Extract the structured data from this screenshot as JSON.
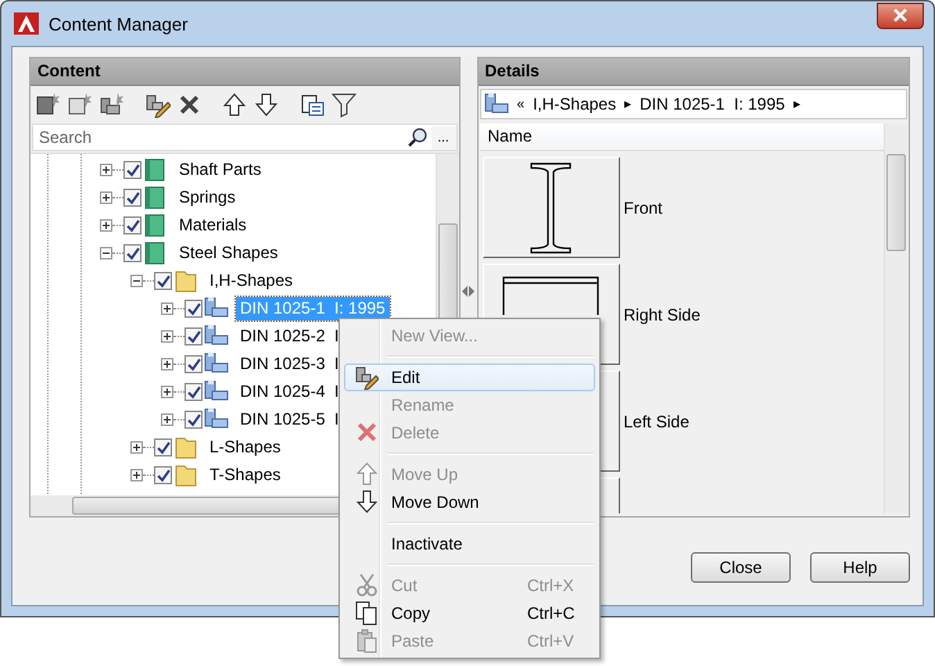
{
  "window": {
    "title": "Content Manager"
  },
  "content_panel": {
    "title": "Content",
    "toolbar": [
      {
        "kind": "new-category"
      },
      {
        "kind": "new-family"
      },
      {
        "kind": "new-member"
      },
      {
        "kind": "edit"
      },
      {
        "kind": "delete"
      },
      {
        "kind": "up"
      },
      {
        "kind": "down"
      },
      {
        "kind": "view"
      },
      {
        "kind": "filter"
      }
    ],
    "search": {
      "placeholder": "Search"
    },
    "search_more": "...",
    "tree": [
      {
        "label": "Shaft Parts",
        "kind": "category",
        "expanded": false,
        "checked": true,
        "selected": false
      },
      {
        "label": "Springs",
        "kind": "category",
        "expanded": false,
        "checked": true,
        "selected": false
      },
      {
        "label": "Materials",
        "kind": "category",
        "expanded": false,
        "checked": true,
        "selected": false
      },
      {
        "label": "Steel Shapes",
        "kind": "category",
        "expanded": true,
        "checked": true,
        "selected": false,
        "children": [
          {
            "label": "I,H-Shapes",
            "kind": "folder",
            "expanded": true,
            "checked": true,
            "selected": false,
            "children": [
              {
                "label": "DIN 1025-1  I: 1995",
                "kind": "part",
                "expanded": false,
                "checked": true,
                "selected": true
              },
              {
                "label": "DIN 1025-2  I",
                "kind": "part",
                "expanded": false,
                "checked": true,
                "selected": false
              },
              {
                "label": "DIN 1025-3  I",
                "kind": "part",
                "expanded": false,
                "checked": true,
                "selected": false
              },
              {
                "label": "DIN 1025-4  I",
                "kind": "part",
                "expanded": false,
                "checked": true,
                "selected": false
              },
              {
                "label": "DIN 1025-5  I",
                "kind": "part",
                "expanded": false,
                "checked": true,
                "selected": false
              }
            ]
          },
          {
            "label": "L-Shapes",
            "kind": "folder",
            "expanded": false,
            "checked": true,
            "selected": false
          },
          {
            "label": "T-Shapes",
            "kind": "folder",
            "expanded": false,
            "checked": true,
            "selected": false
          }
        ]
      }
    ]
  },
  "details_panel": {
    "title": "Details",
    "breadcrumb": [
      {
        "label": "«",
        "kind": "back"
      },
      {
        "label": "I,H-Shapes",
        "kind": "crumb"
      },
      {
        "label": "▸",
        "kind": "arrow"
      },
      {
        "label": "DIN 1025-1  I: 1995",
        "kind": "crumb"
      },
      {
        "label": "▸",
        "kind": "arrow"
      }
    ],
    "column": "Name",
    "views": [
      {
        "label": "Front",
        "kind": "i-beam"
      },
      {
        "label": "Right Side",
        "kind": "side"
      },
      {
        "label": "Left Side",
        "kind": "blank"
      },
      {
        "kind": "blank"
      }
    ]
  },
  "context_menu": [
    {
      "kind": "plain",
      "label": "New View...",
      "disabled": true,
      "highlighted": false
    },
    {
      "kind": "separator"
    },
    {
      "kind": "edit",
      "label": "Edit",
      "disabled": false,
      "highlighted": true
    },
    {
      "kind": "plain",
      "label": "Rename",
      "disabled": true,
      "highlighted": false
    },
    {
      "kind": "delete",
      "label": "Delete",
      "disabled": true,
      "highlighted": false
    },
    {
      "kind": "separator"
    },
    {
      "kind": "up",
      "label": "Move Up",
      "disabled": true,
      "highlighted": false
    },
    {
      "kind": "down",
      "label": "Move Down",
      "disabled": false,
      "highlighted": false
    },
    {
      "kind": "separator"
    },
    {
      "kind": "plain",
      "label": "Inactivate",
      "disabled": false,
      "highlighted": false
    },
    {
      "kind": "separator"
    },
    {
      "kind": "cut",
      "label": "Cut",
      "shortcut": "Ctrl+X",
      "disabled": true,
      "highlighted": false
    },
    {
      "kind": "copy",
      "label": "Copy",
      "shortcut": "Ctrl+C",
      "disabled": false,
      "highlighted": false
    },
    {
      "kind": "paste",
      "label": "Paste",
      "shortcut": "Ctrl+V",
      "disabled": true,
      "highlighted": false
    }
  ],
  "buttons": [
    "Close",
    "Help"
  ]
}
